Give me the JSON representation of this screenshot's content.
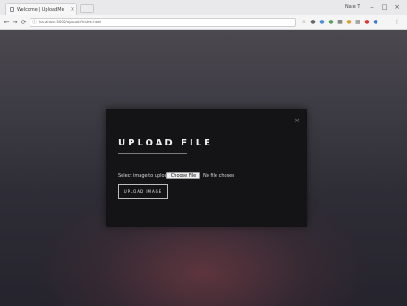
{
  "browser": {
    "tab_title": "Welcome | UploadMe",
    "tab_close": "×",
    "address_url": "localhost:3000/uploads/index.html",
    "profile_name": "Nate T",
    "window_buttons": {
      "minimize": "–",
      "maximize": "□",
      "close": "×"
    },
    "nav": {
      "back": "←",
      "forward": "→",
      "reload": "⟳"
    }
  },
  "modal": {
    "close_label": "×",
    "title": "UPLOAD FILE",
    "file_prompt": "Select image to upload:",
    "choose_file_label": "Choose File",
    "no_file_text": "No file chosen",
    "upload_button": "UPLOAD IMAGE"
  },
  "colors": {
    "modal_bg": "#141417",
    "page_bg_top": "#4b4850",
    "page_bg_bottom": "#25232c",
    "accent_glow": "#703a42"
  },
  "icons": [
    "back-icon",
    "forward-icon",
    "reload-icon",
    "info-icon",
    "star-icon",
    "extension-icon",
    "menu-icon"
  ]
}
